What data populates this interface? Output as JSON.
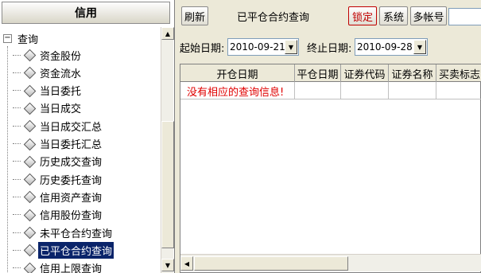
{
  "left_panel": {
    "header": "信用",
    "tree": {
      "root_toggle": "−",
      "root_label": "查询",
      "items": [
        "资金股份",
        "资金流水",
        "当日委托",
        "当日成交",
        "当日成交汇总",
        "当日委托汇总",
        "历史成交查询",
        "历史委托查询",
        "信用资产查询",
        "信用股份查询",
        "未平仓合约查询",
        "已平仓合约查询",
        "信用上限查询"
      ],
      "selected_index": 11
    }
  },
  "toolbar": {
    "refresh_label": "刷新",
    "title": "已平仓合约查询",
    "lock_label": "锁定",
    "system_label": "系统",
    "multi_account_label": "多帐号"
  },
  "filters": {
    "start_label": "起始日期:",
    "start_value": "2010-09-21",
    "end_label": "终止日期:",
    "end_value": "2010-09-28"
  },
  "grid": {
    "columns": [
      "开仓日期",
      "平仓日期",
      "证券代码",
      "证券名称",
      "买卖标志"
    ],
    "empty_message": "没有相应的查询信息!"
  },
  "icons": {
    "scroll_up": "▲",
    "scroll_down": "▼",
    "scroll_left": "◀",
    "dropdown": "▼"
  },
  "colors": {
    "selection": "#0a246a",
    "empty_message": "#e00000",
    "lock_text": "#c00000"
  }
}
